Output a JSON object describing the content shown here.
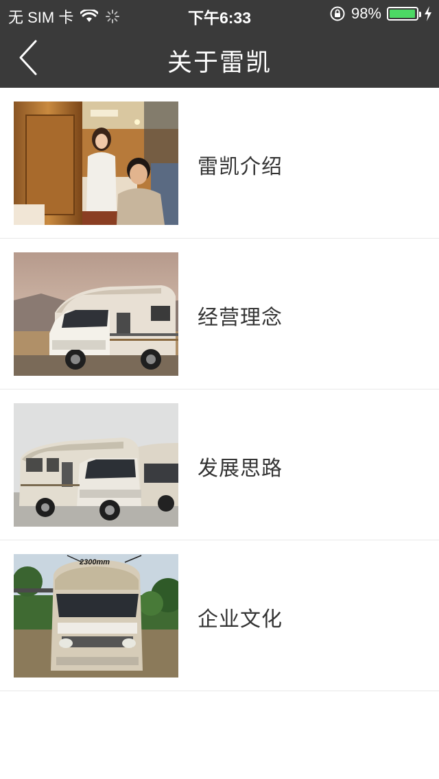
{
  "status_bar": {
    "carrier": "无 SIM 卡",
    "time": "下午6:33",
    "battery_percent": "98%",
    "battery_level": 0.98,
    "battery_color": "#4cd964"
  },
  "nav": {
    "title": "关于雷凯",
    "back_icon": "chevron-left-icon"
  },
  "list": {
    "items": [
      {
        "label": "雷凯介绍",
        "image": "couple-in-rv-interior"
      },
      {
        "label": "经营理念",
        "image": "rv-in-desert"
      },
      {
        "label": "发展思路",
        "image": "rvs-parked"
      },
      {
        "label": "企业文化",
        "image": "rv-front-view"
      }
    ],
    "image_texts": {
      "rv_width": "2300mm"
    }
  },
  "colors": {
    "header_bg": "#3a3a3a",
    "background": "#ffffff",
    "divider": "#e8e8e8"
  }
}
